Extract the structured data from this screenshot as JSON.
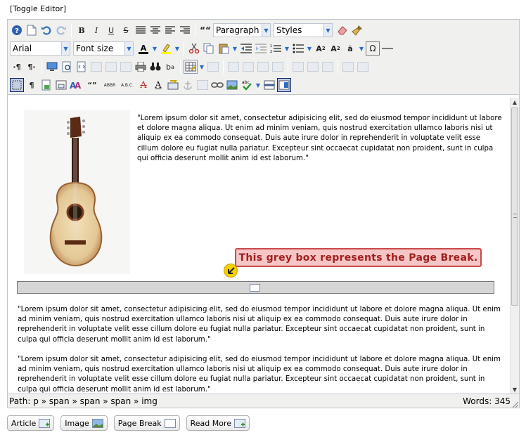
{
  "toggle_editor": "[Toggle Editor]",
  "toolbar": {
    "format_select": "Paragraph",
    "styles_select": "Styles",
    "font_family_select": "Arial",
    "font_size_select": "Font size",
    "abbr_label": "ABBR",
    "acronym_label": "A.B.C.",
    "quote_label": "““"
  },
  "content": {
    "paragraph_1": "\"Lorem ipsum dolor sit amet, consectetur adipisicing elit, sed do eiusmod tempor incididunt ut labore et dolore magna aliqua. Ut enim ad minim veniam, quis nostrud exercitation ullamco laboris nisi ut aliquip ex ea commodo consequat. Duis aute irure dolor in reprehenderit in voluptate velit esse cillum dolore eu fugiat nulla pariatur. Excepteur sint occaecat cupidatat non proident, sunt in culpa qui officia deserunt mollit anim id est laborum.\"",
    "paragraph_2": "\"Lorem ipsum dolor sit amet, consectetur adipisicing elit, sed do eiusmod tempor incididunt ut labore et dolore magna aliqua. Ut enim ad minim veniam, quis nostrud exercitation ullamco laboris nisi ut aliquip ex ea commodo consequat. Duis aute irure dolor in reprehenderit in voluptate velit esse cillum dolore eu fugiat nulla pariatur. Excepteur sint occaecat cupidatat non proident, sunt in culpa qui officia deserunt mollit anim id est laborum.\"",
    "paragraph_3": "\"Lorem ipsum dolor sit amet, consectetur adipisicing elit, sed do eiusmod tempor incididunt ut labore et dolore magna aliqua. Ut enim ad minim veniam, quis nostrud exercitation ullamco laboris nisi ut aliquip ex ea commodo consequat. Duis aute irure dolor in reprehenderit in voluptate velit esse cillum dolore eu fugiat nulla pariatur. Excepteur sint occaecat cupidatat non proident, sunt in culpa qui officia deserunt mollit anim id est laborum.\"",
    "callout": "This grey box represents the Page Break."
  },
  "statusbar": {
    "path": "Path:  p » span » span » span » img",
    "words": "Words: 345"
  },
  "buttons": {
    "article": "Article",
    "image": "Image",
    "page_break": "Page Break",
    "read_more": "Read More"
  },
  "colors": {
    "toolbar_bg": "#f0f0ee",
    "callout_bg": "#f6c6c6",
    "callout_border": "#c94a4a",
    "callout_text": "#a22020",
    "pagebreak_bg": "#d6d6d6"
  }
}
